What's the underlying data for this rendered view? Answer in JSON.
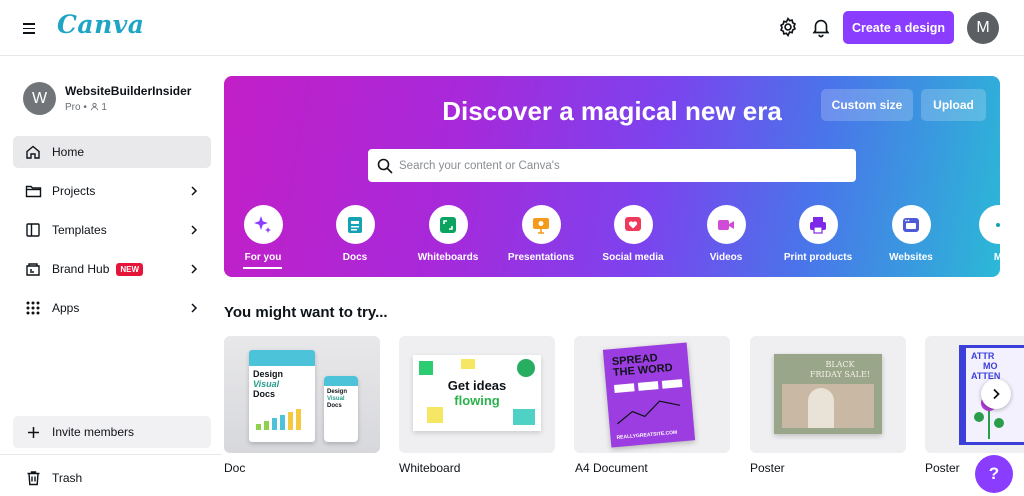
{
  "header": {
    "logo_text": "Canva",
    "create_label": "Create a design",
    "avatar_initial": "M",
    "accent_color": "#8b3dff"
  },
  "team": {
    "initial": "W",
    "name": "WebsiteBuilderInsider",
    "plan": "Pro",
    "members": "1"
  },
  "sidebar": {
    "items": [
      {
        "label": "Home",
        "icon": "home-icon"
      },
      {
        "label": "Projects",
        "icon": "folder-icon"
      },
      {
        "label": "Templates",
        "icon": "templates-icon"
      },
      {
        "label": "Brand Hub",
        "icon": "brand-hub-icon",
        "badge": "NEW"
      },
      {
        "label": "Apps",
        "icon": "apps-grid-icon"
      }
    ],
    "invite_label": "Invite members",
    "trash_label": "Trash"
  },
  "hero": {
    "title": "Discover a magical new era",
    "custom_size_label": "Custom size",
    "upload_label": "Upload",
    "search_placeholder": "Search your content or Canva's",
    "categories": [
      {
        "label": "For you",
        "icon": "sparkle-icon"
      },
      {
        "label": "Docs",
        "icon": "docs-icon"
      },
      {
        "label": "Whiteboards",
        "icon": "whiteboard-icon"
      },
      {
        "label": "Presentations",
        "icon": "presentation-icon"
      },
      {
        "label": "Social media",
        "icon": "heart-icon"
      },
      {
        "label": "Videos",
        "icon": "video-icon"
      },
      {
        "label": "Print products",
        "icon": "printer-icon"
      },
      {
        "label": "Websites",
        "icon": "website-icon"
      },
      {
        "label": "M",
        "icon": "more-icon"
      }
    ]
  },
  "suggestions": {
    "title": "You might want to try...",
    "cards": [
      {
        "label": "Doc",
        "thumb_line1": "Design",
        "thumb_line2": "Visual",
        "thumb_line3": "Docs"
      },
      {
        "label": "Whiteboard",
        "thumb_line1": "Get ideas",
        "thumb_line2": "flowing"
      },
      {
        "label": "A4 Document",
        "thumb_line1": "SPREAD",
        "thumb_line2": "THE WORD",
        "thumb_line3": "REALLYGREATSITE.COM"
      },
      {
        "label": "Poster",
        "thumb_line1": "BLACK",
        "thumb_line2": "FRIDAY SALE!"
      },
      {
        "label": "Poster",
        "thumb_line1": "ATTR",
        "thumb_line2": "MO",
        "thumb_line3": "ATTEN"
      }
    ]
  },
  "help_label": "?"
}
